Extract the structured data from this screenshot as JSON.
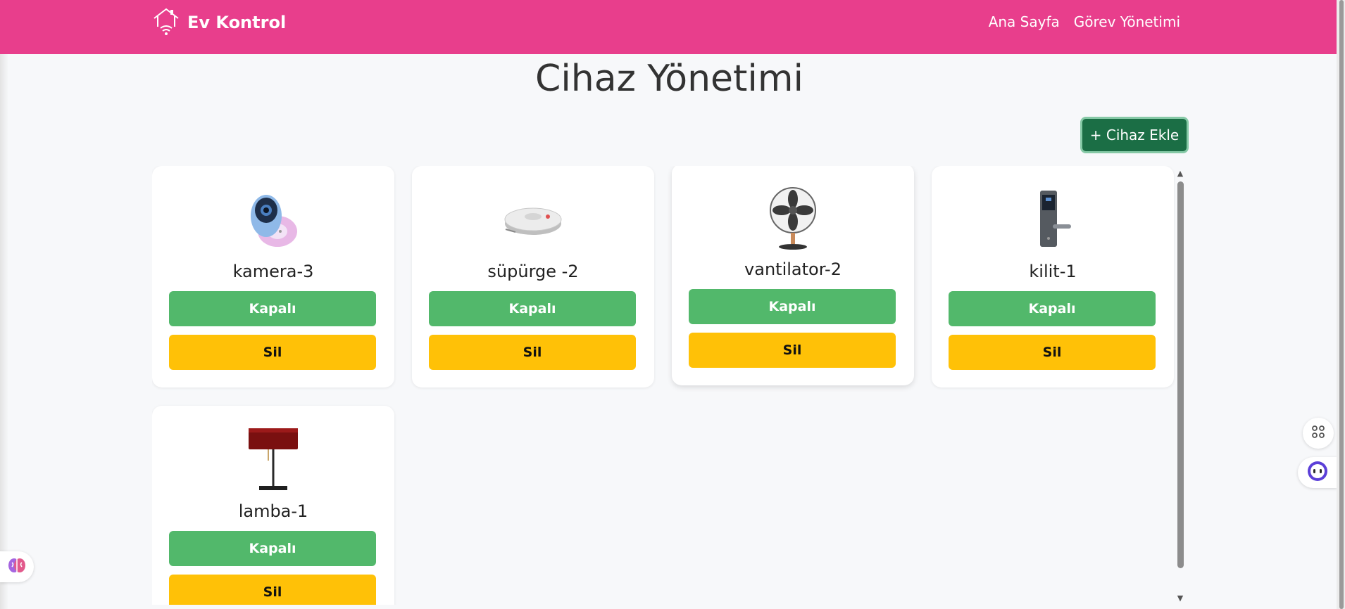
{
  "navbar": {
    "brand": "Ev Kontrol",
    "links": [
      "Ana Sayfa",
      "Görev Yönetimi"
    ]
  },
  "page": {
    "title": "Cihaz Yönetimi",
    "add_button": "+ Cihaz Ekle"
  },
  "devices": [
    {
      "name": "kamera-3",
      "icon": "camera-icon",
      "toggle_label": "Kapalı",
      "delete_label": "Sil"
    },
    {
      "name": "süpürge -2",
      "icon": "robot-vacuum-icon",
      "toggle_label": "Kapalı",
      "delete_label": "Sil"
    },
    {
      "name": "vantilator-2",
      "icon": "fan-icon",
      "toggle_label": "Kapalı",
      "delete_label": "Sil"
    },
    {
      "name": "kilit-1",
      "icon": "door-lock-icon",
      "toggle_label": "Kapalı",
      "delete_label": "Sil"
    },
    {
      "name": "lamba-1",
      "icon": "lamp-icon",
      "toggle_label": "Kapalı",
      "delete_label": "Sil"
    }
  ],
  "colors": {
    "navbar": "#e83e8c",
    "add_button": "#1b6e45",
    "toggle": "#52b86b",
    "delete": "#ffc107",
    "background": "#f7f8fa"
  }
}
